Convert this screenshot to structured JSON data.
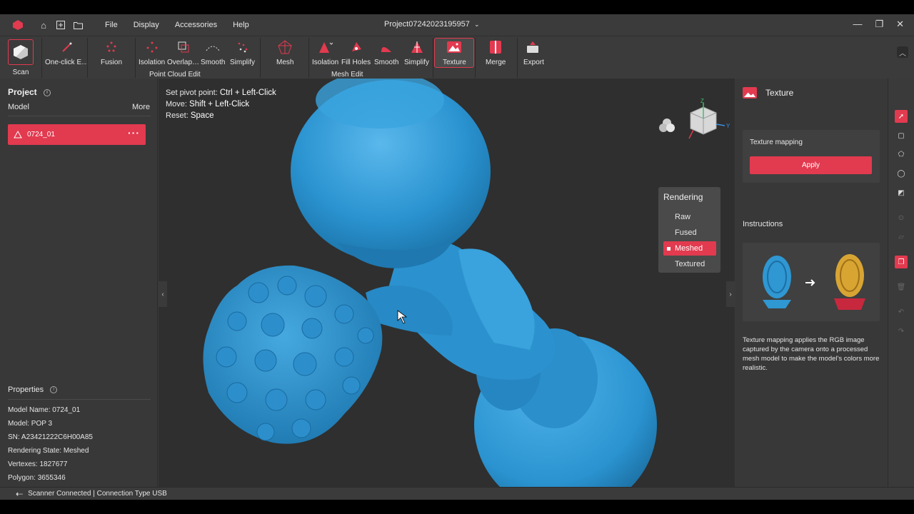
{
  "menu": [
    "File",
    "Display",
    "Accessories",
    "Help"
  ],
  "project_title": "Project07242023195957",
  "toolbar": {
    "scan_label": "Scan",
    "point_cloud_tools": [
      "One-click E…",
      "Fusion",
      "Isolation",
      "Overlap…",
      "Smooth",
      "Simplify"
    ],
    "point_cloud_group": "Point Cloud Edit",
    "mesh_label": "Mesh",
    "mesh_tools": [
      "Isolation",
      "Fill Holes",
      "Smooth",
      "Simplify"
    ],
    "mesh_group": "Mesh Edit",
    "texture_label": "Texture",
    "merge_label": "Merge",
    "export_label": "Export"
  },
  "left": {
    "title": "Project",
    "model_header": "Model",
    "more": "More",
    "model_item": "0724_01",
    "properties_title": "Properties",
    "properties": [
      "Model Name:  0724_01",
      "Model:  POP 3",
      "SN:  A23421222C6H00A85",
      "Rendering State:  Meshed",
      "Vertexes:  1827677",
      "Polygon:  3655346"
    ]
  },
  "viewport": {
    "hints": [
      {
        "k": "Set pivot point:",
        "v": "Ctrl + Left-Click"
      },
      {
        "k": "Move:",
        "v": "Shift + Left-Click"
      },
      {
        "k": "Reset:",
        "v": "Space"
      }
    ],
    "rendering": {
      "title": "Rendering",
      "options": [
        "Raw",
        "Fused",
        "Meshed",
        "Textured"
      ],
      "selected": "Meshed"
    },
    "axes": {
      "z": "Z",
      "y": "Y"
    },
    "model_color": "#2f97d2"
  },
  "right": {
    "title": "Texture",
    "mapping_label": "Texture mapping",
    "apply": "Apply",
    "instructions_title": "Instructions",
    "instructions_text": "Texture mapping applies the RGB image captured by the camera onto a processed mesh model to make the model's colors more realistic."
  },
  "status": "Scanner Connected | Connection Type USB",
  "accent": "#e23a4f"
}
